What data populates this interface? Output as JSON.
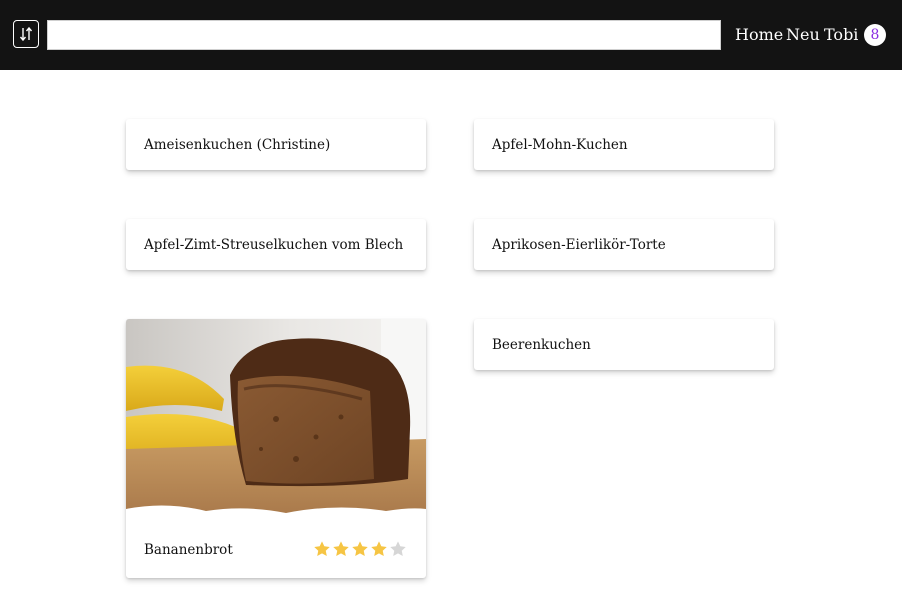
{
  "nav": {
    "sort_icon": "sort-arrows-icon",
    "search": {
      "value": "",
      "placeholder": ""
    },
    "links": [
      {
        "label": "Home"
      },
      {
        "label": "Neu"
      },
      {
        "label": "Tobi"
      }
    ],
    "badge": "8",
    "badge_color": "#8a2be2"
  },
  "recipes": [
    {
      "title": "Ameisenkuchen (Christine)"
    },
    {
      "title": "Apfel-Mohn-Kuchen"
    },
    {
      "title": "Apfel-Zimt-Streuselkuchen vom Blech"
    },
    {
      "title": "Aprikosen-Eierlikör-Torte"
    },
    {
      "title": "Bananenbrot",
      "image": "banana-bread-photo",
      "rating": 4,
      "max_rating": 5
    },
    {
      "title": "Beerenkuchen"
    }
  ],
  "colors": {
    "header_bg": "#131313",
    "star_filled": "#f6c544",
    "star_empty": "#d6d6d6"
  }
}
